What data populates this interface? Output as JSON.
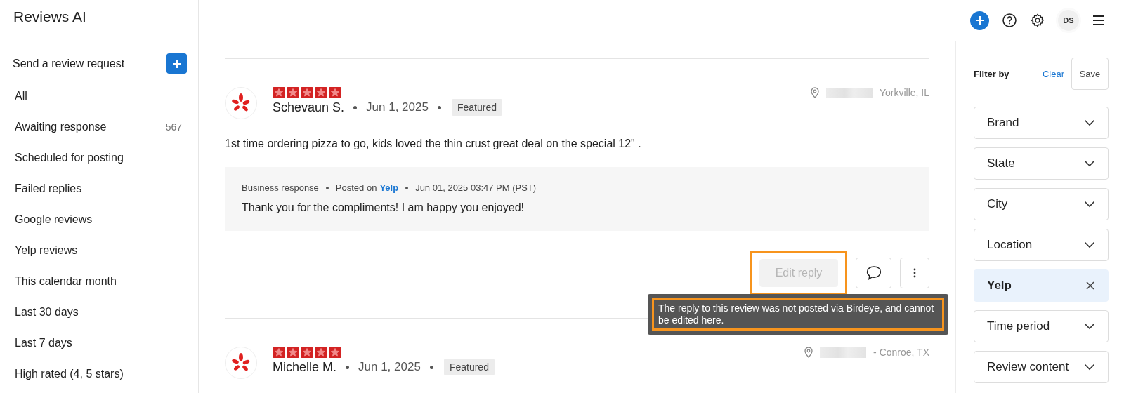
{
  "app": {
    "title": "Reviews AI"
  },
  "header": {
    "avatar": "DS"
  },
  "sidebar": {
    "request": "Send a review request",
    "items": [
      {
        "label": "All",
        "selected": false
      },
      {
        "label": "Awaiting response",
        "count": "567",
        "selected": false
      },
      {
        "label": "Scheduled for posting",
        "selected": false
      },
      {
        "label": "Failed replies",
        "selected": false
      },
      {
        "label": "Google reviews",
        "selected": false
      },
      {
        "label": "Yelp reviews",
        "selected": false
      },
      {
        "label": "This calendar month",
        "selected": false
      },
      {
        "label": "Last 30 days",
        "selected": false
      },
      {
        "label": "Last 7 days",
        "selected": false
      },
      {
        "label": "High rated (4, 5 stars)",
        "selected": false
      }
    ]
  },
  "reviews": [
    {
      "name": "Schevaun S.",
      "date": "Jun 1, 2025",
      "stars": 5,
      "badge": "Featured",
      "location": "Yorkville, IL",
      "text": "1st time ordering pizza to go, kids loved the thin crust great deal on the special 12\" .",
      "response": {
        "label": "Business response",
        "posted_on": "Posted on",
        "source": "Yelp",
        "time": "Jun 01, 2025 03:47 PM (PST)",
        "text": "Thank you for the compliments! I am happy you enjoyed!"
      },
      "actions": {
        "edit": "Edit reply",
        "disabled": true,
        "highlighted": true
      },
      "tooltip": {
        "text": "The reply to this review was not posted via Birdeye, and cannot be edited here.",
        "highlighted": true
      }
    },
    {
      "name": "Michelle M.",
      "date": "Jun 1, 2025",
      "stars": 5,
      "badge": "Featured",
      "location": "- Conroe, TX"
    }
  ],
  "filters": {
    "title": "Filter by",
    "clear": "Clear",
    "save": "Save",
    "items": [
      {
        "label": "Brand",
        "selected": false
      },
      {
        "label": "State",
        "selected": false
      },
      {
        "label": "City",
        "selected": false
      },
      {
        "label": "Location",
        "selected": false
      },
      {
        "label": "Yelp",
        "selected": true
      },
      {
        "label": "Time period",
        "selected": false
      },
      {
        "label": "Review content",
        "selected": false
      }
    ]
  }
}
